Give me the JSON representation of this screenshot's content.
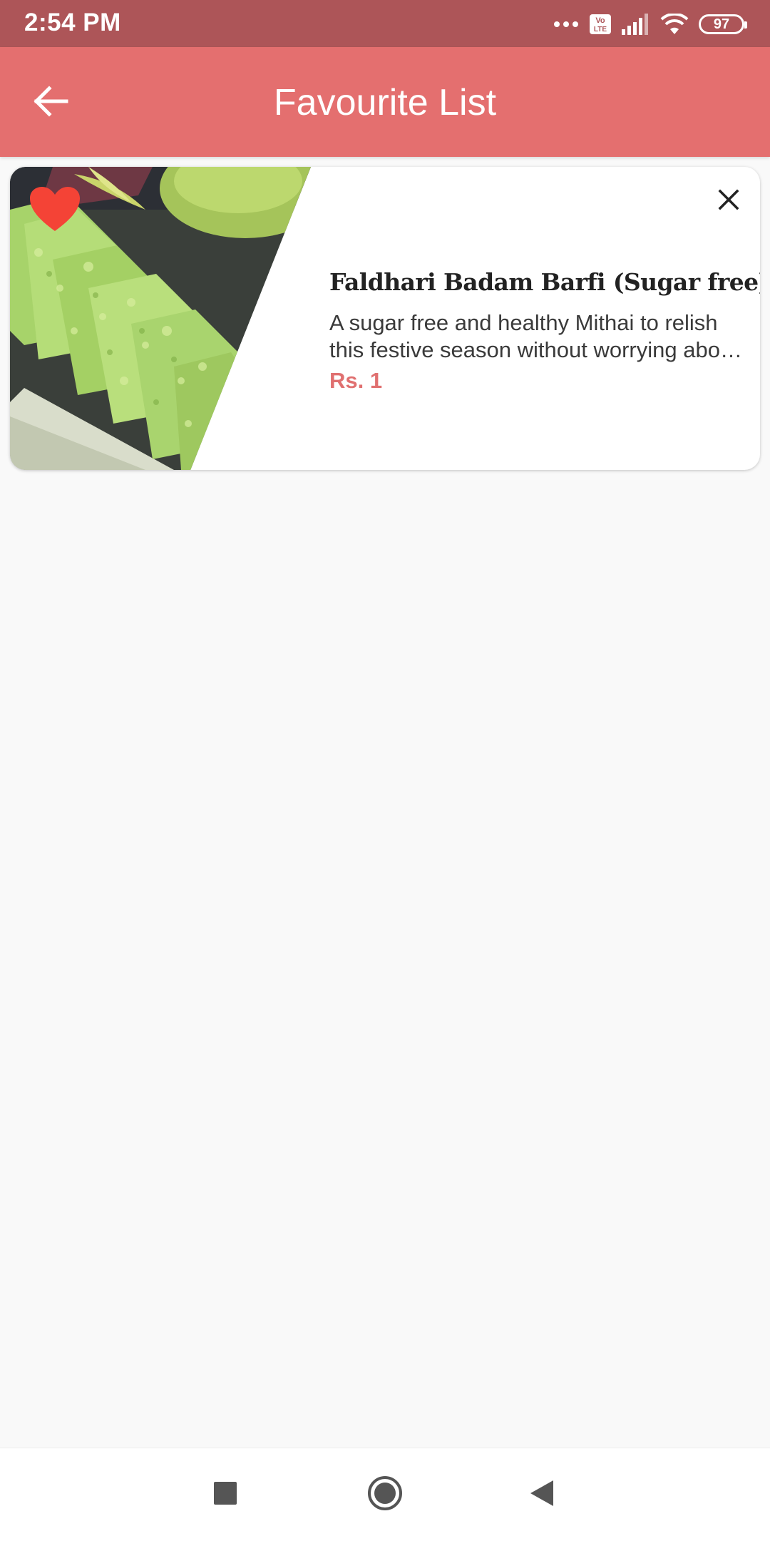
{
  "status_bar": {
    "time": "2:54 PM",
    "network_badge": "Vo LTE",
    "battery": "97",
    "icons": [
      "dots-icon",
      "volte-icon",
      "signal-icon",
      "wifi-icon",
      "battery-icon"
    ]
  },
  "app_bar": {
    "title": "Favourite List",
    "back_icon": "arrow-left-icon",
    "background": "#e46f6f"
  },
  "favourites": [
    {
      "title": "Faldhari Badam Barfi (Sugar free)",
      "description": "A sugar free and healthy Mithai to relish this festive season without worrying about the calories.",
      "price": "Rs. 1",
      "favourite_icon": "heart-icon",
      "remove_icon": "close-icon"
    }
  ],
  "nav_bar": {
    "icons": [
      "square-recent-icon",
      "circle-home-icon",
      "triangle-back-icon"
    ]
  },
  "colors": {
    "status_bar": "#ad5558",
    "accent": "#e46f6f",
    "price": "#e07070",
    "heart": "#f44336"
  }
}
